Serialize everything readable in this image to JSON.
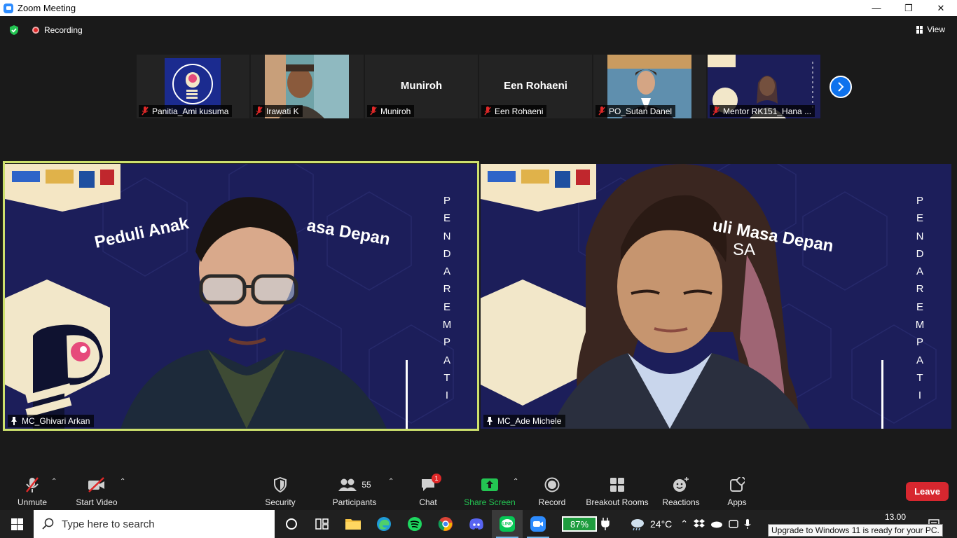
{
  "window": {
    "title": "Zoom Meeting",
    "minimize": "—",
    "maximize": "❐",
    "close": "✕"
  },
  "topbar": {
    "recording_label": "Recording",
    "view_label": "View"
  },
  "thumbnails": [
    {
      "name": "Panitia_Ami kusuma",
      "video": "logo"
    },
    {
      "name": "Irawati K",
      "video": "camera"
    },
    {
      "name": "Muniroh",
      "center_name": "Muniroh",
      "video": "none"
    },
    {
      "name": "Een Rohaeni",
      "center_name": "Een Rohaeni",
      "video": "none"
    },
    {
      "name": "PO_Sutan Danel",
      "video": "camera"
    },
    {
      "name": "Mentor RK151_Hana ...",
      "video": "camera"
    }
  ],
  "main_videos": [
    {
      "name": "MC_Ghivari Arkan",
      "banner": "Peduli Anak",
      "banner2": "asa Depan",
      "vertical": "PENDAREMPATI",
      "active_speaker": true
    },
    {
      "name": "MC_Ade Michele",
      "banner": "uli Masa Depan",
      "banner2": "SA",
      "vertical": "PENDAREMPATI",
      "active_speaker": false
    }
  ],
  "toolbar": {
    "unmute": "Unmute",
    "start_video": "Start Video",
    "security": "Security",
    "participants": "Participants",
    "participants_count": "55",
    "chat": "Chat",
    "chat_badge": "1",
    "share_screen": "Share Screen",
    "record": "Record",
    "breakout_rooms": "Breakout Rooms",
    "reactions": "Reactions",
    "apps": "Apps",
    "leave": "Leave"
  },
  "taskbar": {
    "search_placeholder": "Type here to search",
    "battery": "87%",
    "temperature": "24°C",
    "time": "13.00",
    "tooltip": "Upgrade to Windows 11 is ready for your PC."
  },
  "colors": {
    "accent_blue": "#0e72ed",
    "speaker_border": "#cde06d",
    "leave_red": "#d7272f",
    "share_green": "#23c552"
  }
}
